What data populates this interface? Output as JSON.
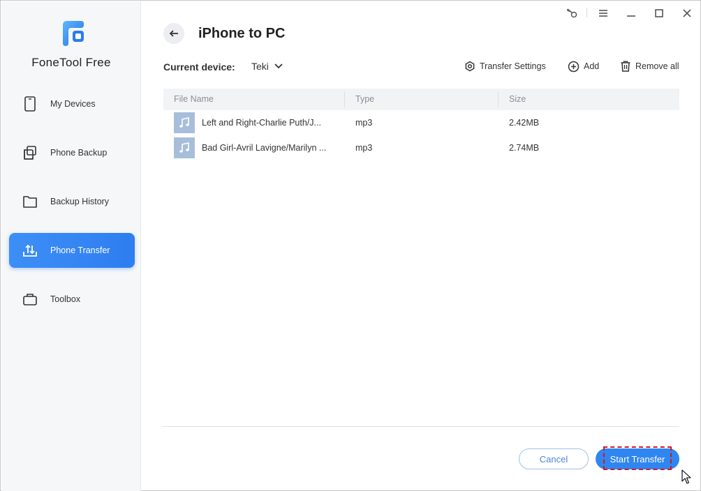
{
  "app": {
    "name": "FoneTool Free",
    "accent": "#2f86f0"
  },
  "sidebar": {
    "items": [
      {
        "label": "My Devices",
        "icon": "phone-icon"
      },
      {
        "label": "Phone Backup",
        "icon": "copy-icon"
      },
      {
        "label": "Backup History",
        "icon": "folder-icon"
      },
      {
        "label": "Phone Transfer",
        "icon": "transfer-icon",
        "active": true
      },
      {
        "label": "Toolbox",
        "icon": "briefcase-icon"
      }
    ]
  },
  "window_controls": [
    "key-icon",
    "menu-icon",
    "minimize-icon",
    "maximize-icon",
    "close-icon"
  ],
  "header": {
    "title": "iPhone to PC",
    "device_label": "Current device:",
    "device_value": "Teki"
  },
  "toolbar": {
    "transfer_settings": "Transfer Settings",
    "add": "Add",
    "remove_all": "Remove all"
  },
  "table": {
    "columns": [
      "File Name",
      "Type",
      "Size"
    ],
    "rows": [
      {
        "name": "Left and Right-Charlie Puth/J...",
        "type": "mp3",
        "size": "2.42MB"
      },
      {
        "name": "Bad Girl-Avril Lavigne/Marilyn ...",
        "type": "mp3",
        "size": "2.74MB"
      }
    ]
  },
  "footer": {
    "cancel": "Cancel",
    "start": "Start Transfer"
  }
}
